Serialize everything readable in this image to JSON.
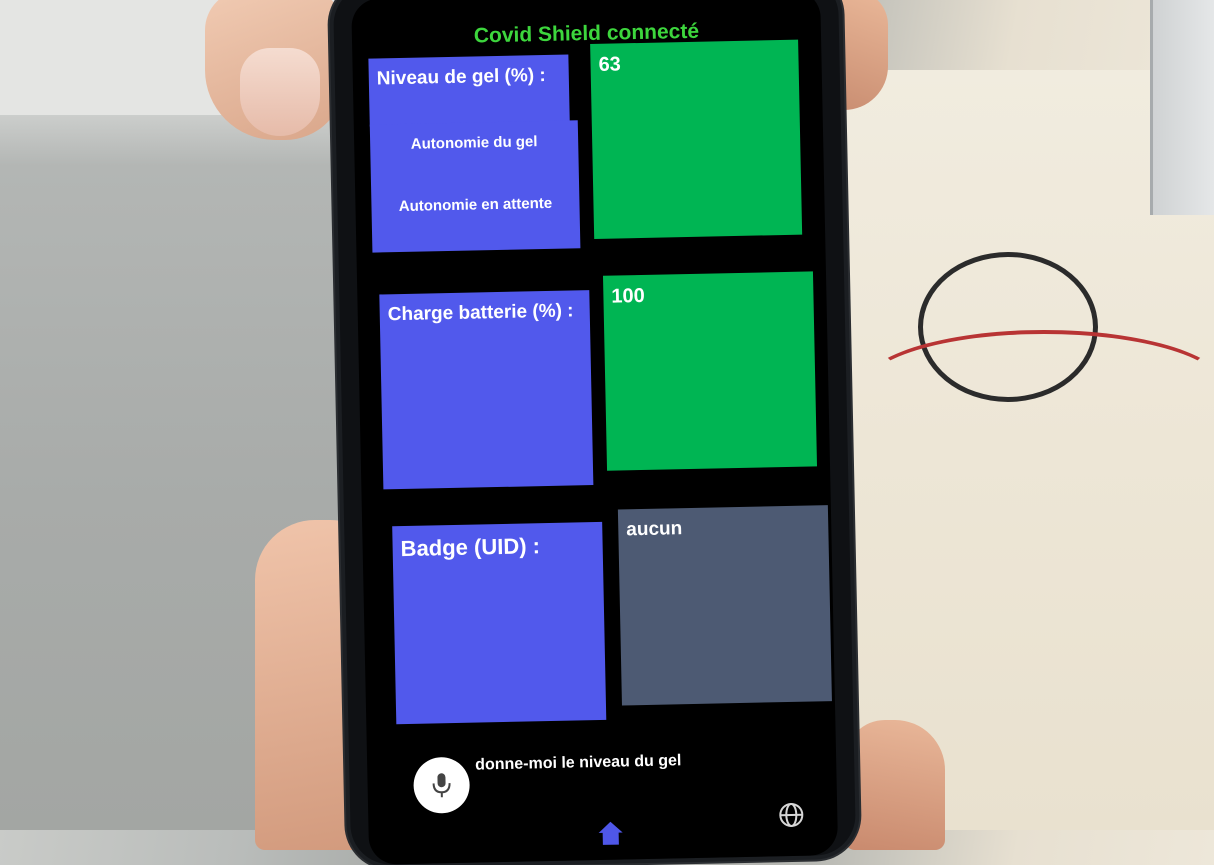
{
  "app": {
    "status_title": "Covid Shield connecté"
  },
  "tiles": {
    "gel_label": "Niveau de gel (%) :",
    "gel_value": "63",
    "autonomy_gel": "Autonomie du gel",
    "autonomy_standby": "Autonomie en attente",
    "battery_label": "Charge batterie (%) :",
    "battery_value": "100",
    "badge_label": "Badge (UID) :",
    "badge_value": "aucun"
  },
  "voice": {
    "query_text": "donne-moi le niveau du gel",
    "mic_icon": "microphone-icon"
  },
  "nav": {
    "home_icon": "home-icon",
    "web_icon": "globe-icon"
  },
  "colors": {
    "status_green": "#3dd63d",
    "tile_blue": "#5159ec",
    "tile_green": "#00b553",
    "tile_grey": "#4d5a73"
  }
}
